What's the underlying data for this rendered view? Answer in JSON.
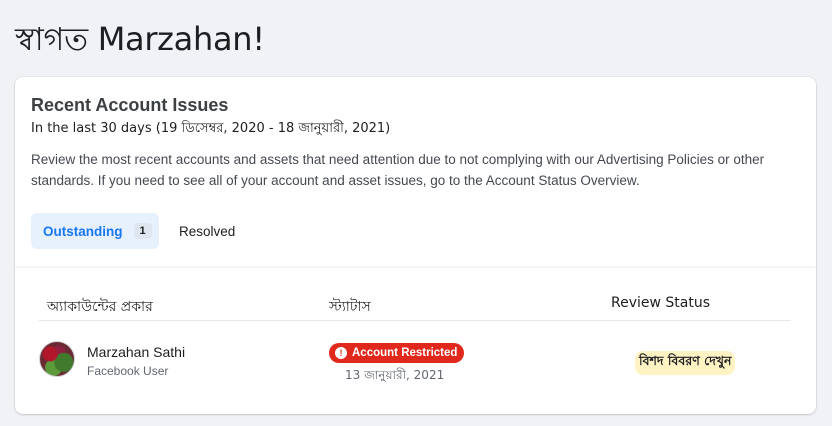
{
  "greeting": "স্বাগত Marzahan!",
  "issues": {
    "title": "Recent Account Issues",
    "date_range": "In the last 30 days (19 ডিসেম্বর, 2020 - 18 জানুয়ারী, 2021)",
    "description": "Review the most recent accounts and assets that need attention due to not complying with our Advertising Policies or other standards. If you need to see all of your account and asset issues, go to the Account Status Overview.",
    "tabs": {
      "outstanding_label": "Outstanding",
      "outstanding_count": "1",
      "resolved_label": "Resolved"
    },
    "table": {
      "headers": [
        "অ্যাকাউন্টের প্রকার",
        "স্ট্যাটাস",
        "Review Status"
      ],
      "rows": [
        {
          "name": "Marzahan Sathi",
          "type": "Facebook User",
          "status_badge": "Account Restricted",
          "status_date": "13 জানুয়ারী, 2021",
          "review_link": "বিশদ বিবরণ দেখুন"
        }
      ]
    }
  },
  "colors": {
    "accent": "#1877f2",
    "restricted": "#e0291c",
    "review_highlight": "#fff3c4"
  },
  "icons": {
    "restricted_icon": "exclamation-circle-icon"
  }
}
